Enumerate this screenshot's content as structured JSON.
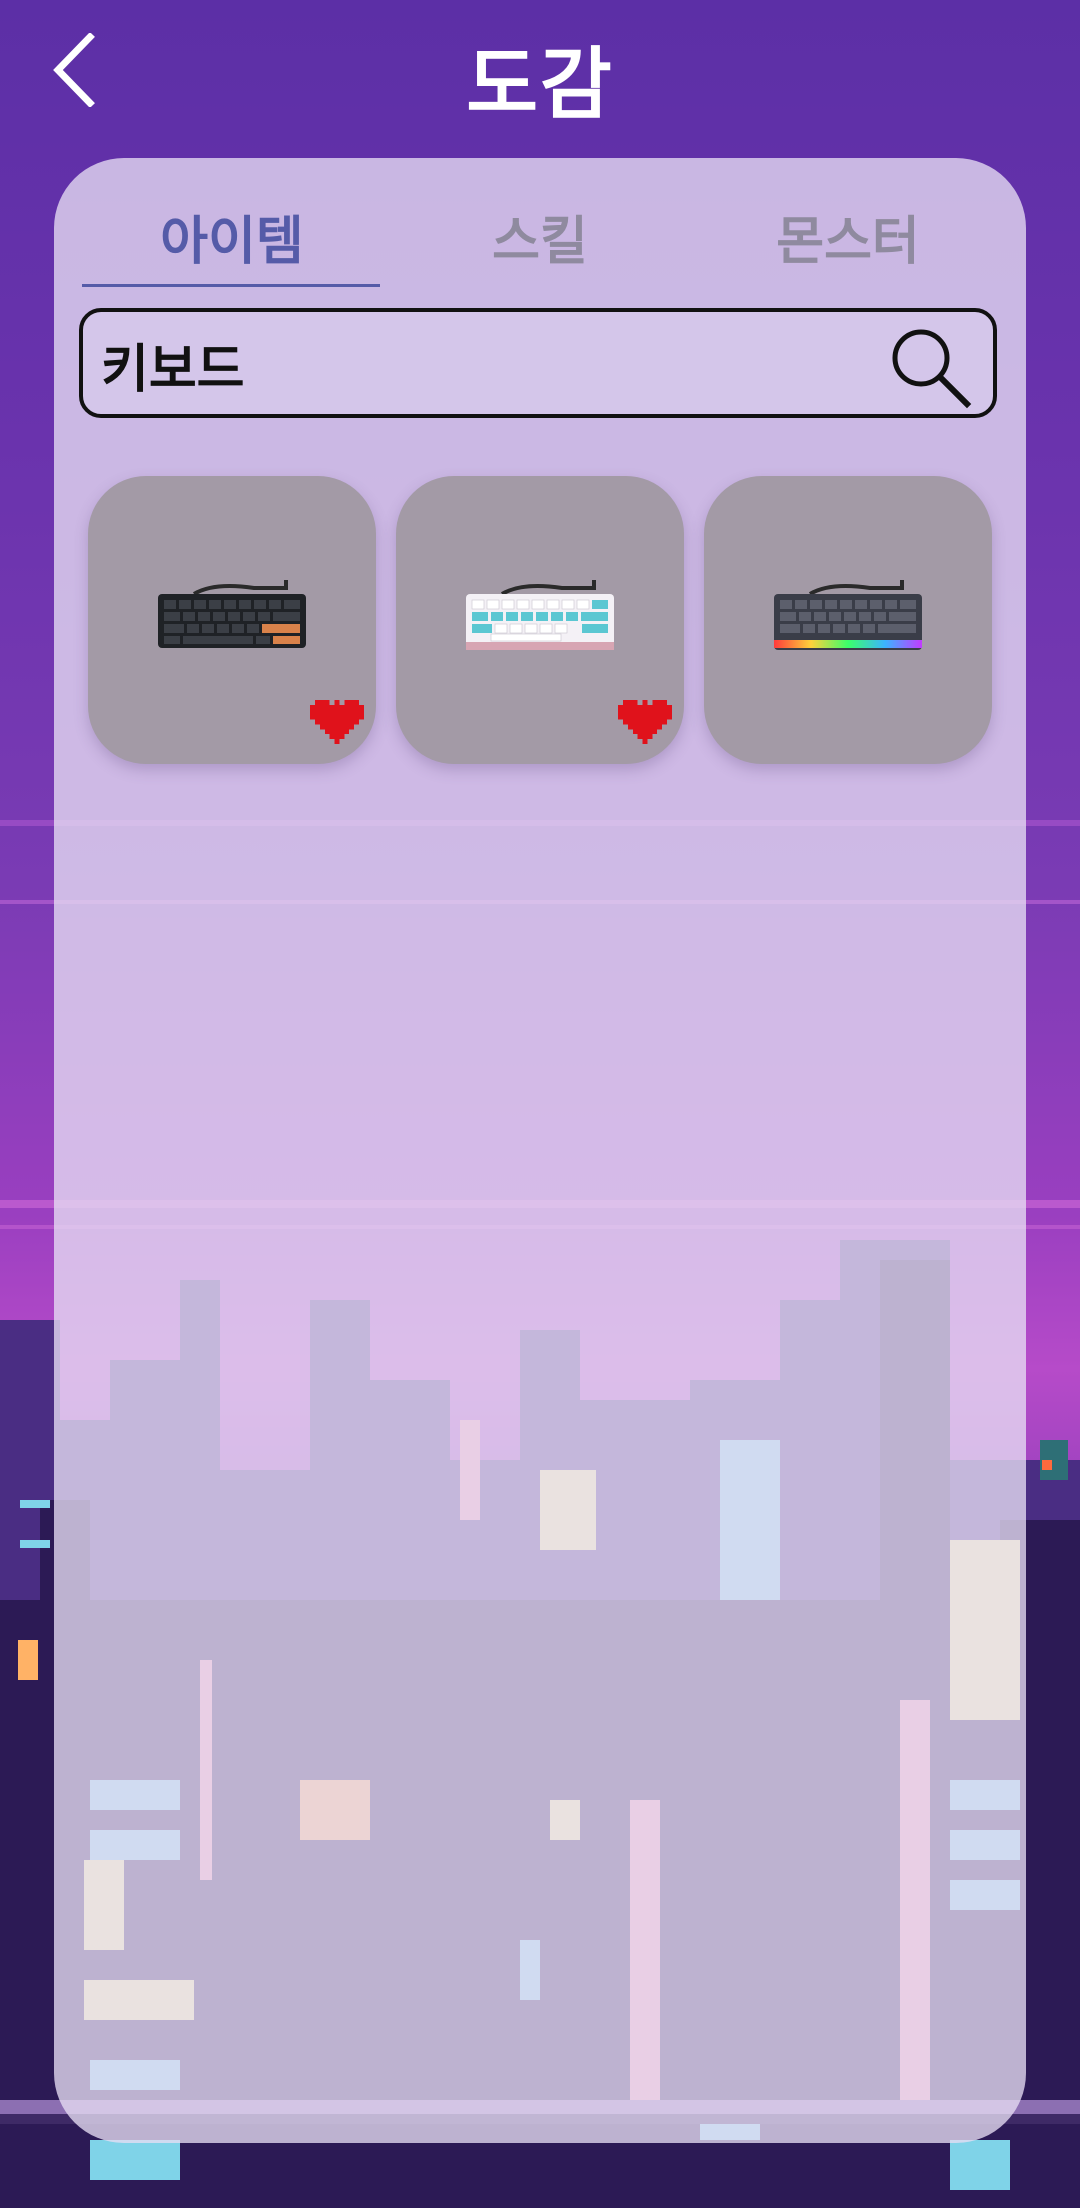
{
  "header": {
    "title": "도감"
  },
  "tabs": [
    {
      "label": "아이템",
      "active": true
    },
    {
      "label": "스킬",
      "active": false
    },
    {
      "label": "몬스터",
      "active": false
    }
  ],
  "search": {
    "value": "키보드"
  },
  "items": [
    {
      "icon": "keyboard-black-icon",
      "favorite": true
    },
    {
      "icon": "keyboard-cyan-white-icon",
      "favorite": true
    },
    {
      "icon": "keyboard-rgb-icon",
      "favorite": false
    }
  ],
  "colors": {
    "accent": "#555ba8",
    "heart": "#e0121b",
    "panel": "#e7def4"
  }
}
